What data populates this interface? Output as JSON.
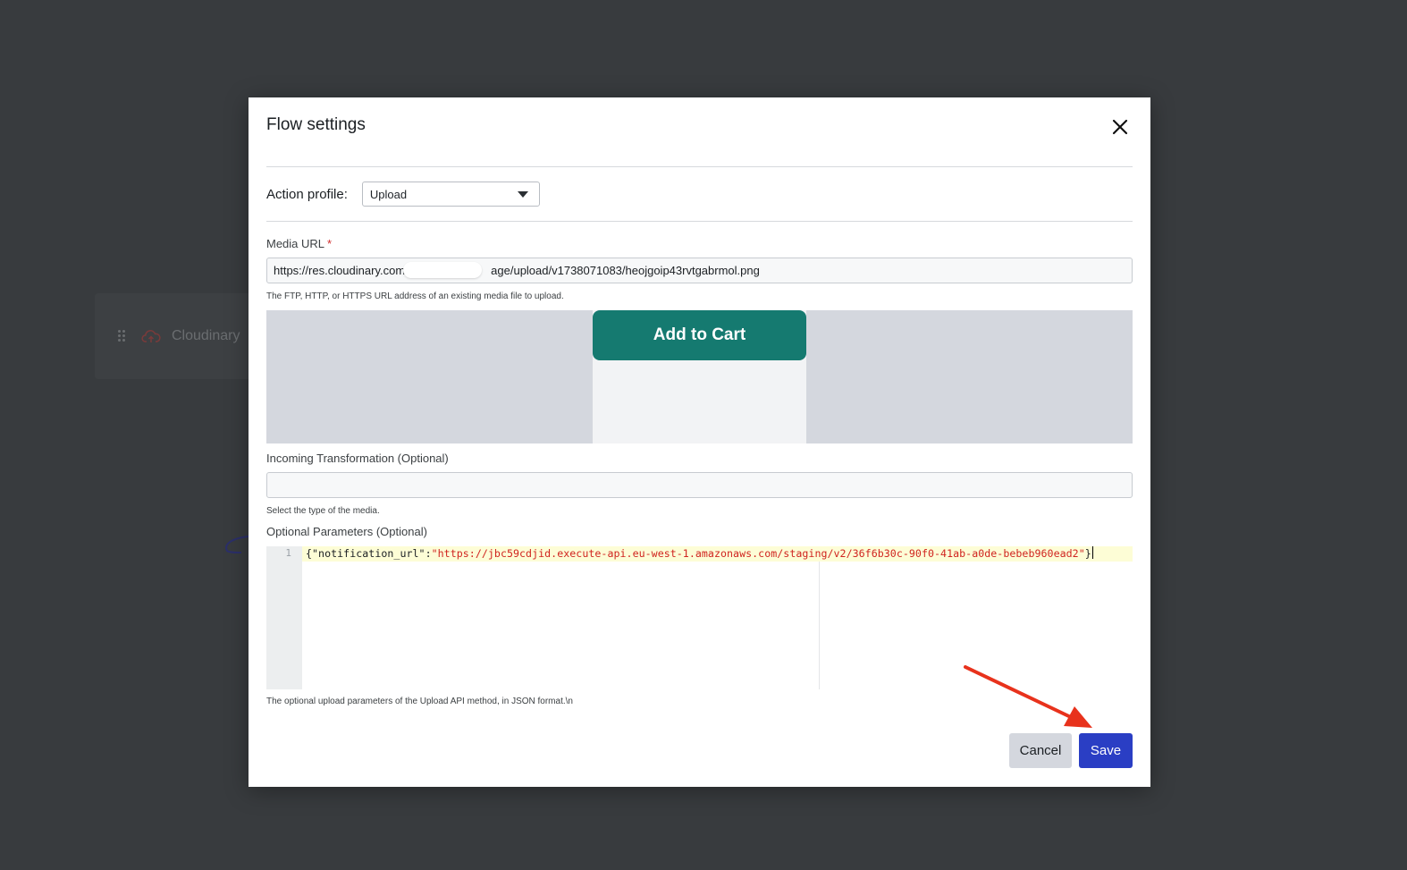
{
  "background": {
    "node_label": "Cloudinary"
  },
  "modal": {
    "title": "Flow settings",
    "action_profile": {
      "label": "Action profile:",
      "selected": "Upload"
    },
    "media_url": {
      "label": "Media URL",
      "required_mark": "*",
      "value_prefix": "https://res.cloudinary.com",
      "value_suffix": "age/upload/v1738071083/heojgoip43rvtgabrmol.png",
      "help": "The FTP, HTTP, or HTTPS URL address of an existing media file to upload."
    },
    "preview": {
      "button_text": "Add to Cart"
    },
    "incoming_transformation": {
      "label": "Incoming Transformation (Optional)",
      "value": "",
      "help": "Select the type of the media."
    },
    "optional_parameters": {
      "label": "Optional Parameters (Optional)",
      "line_number": "1",
      "code": {
        "open": "{",
        "key": "\"notification_url\"",
        "colon": ":",
        "value": "\"https://jbc59cdjid.execute-api.eu-west-1.amazonaws.com/staging/v2/36f6b30c-90f0-41ab-a0de-bebeb960ead2\"",
        "close": "}"
      },
      "help": "The optional upload parameters of the Upload API method, in JSON format.\\n"
    },
    "buttons": {
      "cancel": "Cancel",
      "save": "Save"
    }
  },
  "colors": {
    "overlay": "#383b3e",
    "primary": "#2a3ec4",
    "annotation_arrow": "#e8321c",
    "preview_button": "#157a70"
  }
}
